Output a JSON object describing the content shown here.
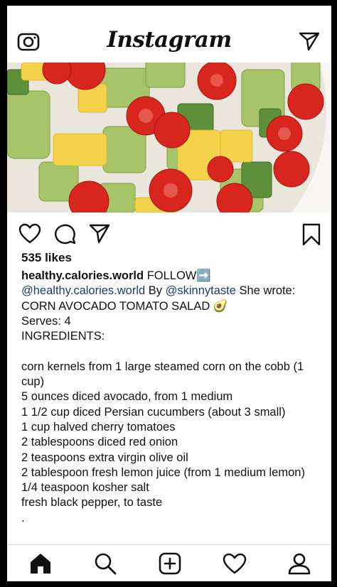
{
  "app": {
    "title": "Instagram"
  },
  "header": {
    "camera_icon": "camera-icon",
    "direct_icon": "paper-plane-icon"
  },
  "post": {
    "likes": "535 likes",
    "username": "healthy.calories.world",
    "follow_label": "FOLLOW",
    "follow_emoji": "➡️",
    "mention_1": "@healthy.calories.world",
    "by_text": " By ",
    "mention_2": "@skinnytaste",
    "she_wrote": " She wrote:",
    "recipe_title": "CORN AVOCADO TOMATO SALAD",
    "avocado_emoji": "🥑",
    "serves": "Serves: 4",
    "ingredients_heading": "INGREDIENTS:",
    "ingredients": [
      "corn kernels from 1 large steamed corn on the cobb (1 cup)",
      "5 ounces diced avocado, from 1 medium",
      "1 1/2 cup diced Persian cucumbers (about 3 small)",
      "1 cup halved cherry tomatoes",
      "2 tablespoons diced red onion",
      "2 teaspoons extra virgin olive oil",
      "2 tablespoon fresh lemon juice (from 1 medium lemon)",
      "1/4 teaspoon kosher salt",
      "fresh black pepper, to taste"
    ],
    "trailing": "."
  },
  "actions": [
    "heart-icon",
    "comment-icon",
    "share-icon",
    "bookmark-icon"
  ],
  "tabbar": [
    "home-icon",
    "search-icon",
    "add-post-icon",
    "activity-heart-icon",
    "profile-icon"
  ]
}
